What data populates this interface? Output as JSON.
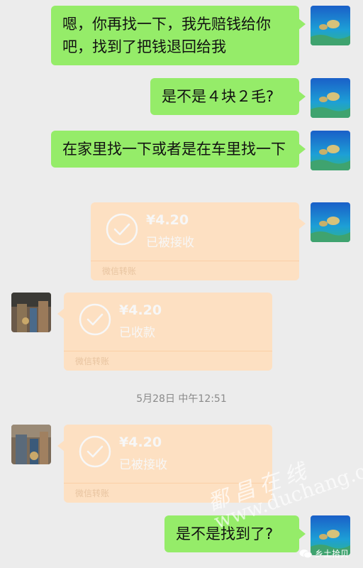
{
  "messages": [
    {
      "text": "嗯，你再找一下，我先赔钱给你吧，找到了把钱退回给我"
    },
    {
      "text": "是不是４块２毛?"
    },
    {
      "text": "在家里找一下或者是在车里找一下"
    },
    {
      "text": "是不是找到了?"
    }
  ],
  "transfers": [
    {
      "amount": "¥4.20",
      "status": "已被接收",
      "label": "微信转账"
    },
    {
      "amount": "¥4.20",
      "status": "已收款",
      "label": "微信转账"
    },
    {
      "amount": "¥4.20",
      "status": "已被接收",
      "label": "微信转账"
    }
  ],
  "timestamp": "5月28日 中午12:51",
  "watermark": {
    "title": "鄱昌在线",
    "url": "www.duchang.org"
  },
  "source_tag": "乡土拾贝",
  "colors": {
    "background": "#ececec",
    "bubble_green": "#95ec69",
    "transfer_bg": "#fde0c2"
  },
  "icons": {
    "transfer_check": "check-circle-icon",
    "source": "wechat-icon"
  }
}
